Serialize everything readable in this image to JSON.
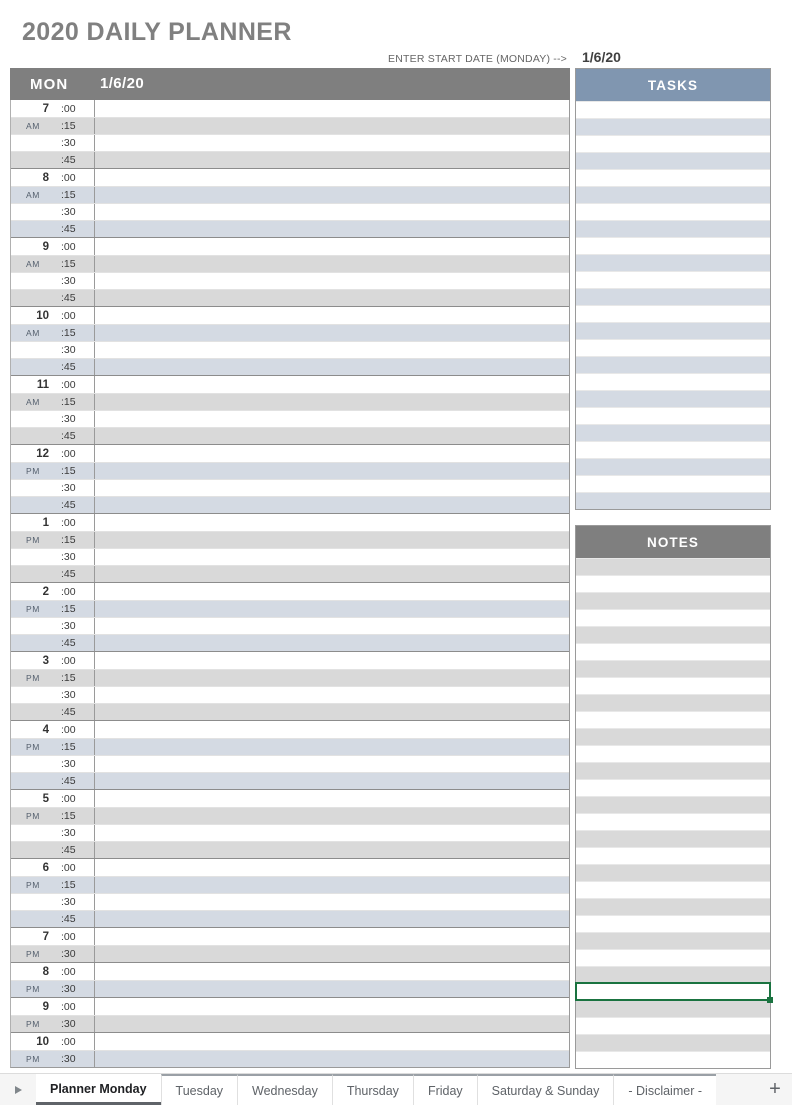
{
  "document": {
    "title": "2020 DAILY PLANNER"
  },
  "header": {
    "start_date_prompt": "ENTER START DATE (MONDAY) -->",
    "start_date_value": "1/6/20",
    "day_of_week": "MON",
    "day_date": "1/6/20"
  },
  "colors": {
    "title_gray": "#808080",
    "header_gray": "#7f7f7f",
    "tasks_blue": "#8096b0",
    "stripe_gray": "#d9d9d9",
    "stripe_blue": "#d4dae3",
    "selection_green": "#1a7340"
  },
  "schedule": {
    "hours": [
      {
        "hour": "7",
        "ampm": "AM",
        "stripe": "gray",
        "minutes": [
          ":00",
          ":15",
          ":30",
          ":45"
        ]
      },
      {
        "hour": "8",
        "ampm": "AM",
        "stripe": "blue",
        "minutes": [
          ":00",
          ":15",
          ":30",
          ":45"
        ]
      },
      {
        "hour": "9",
        "ampm": "AM",
        "stripe": "gray",
        "minutes": [
          ":00",
          ":15",
          ":30",
          ":45"
        ]
      },
      {
        "hour": "10",
        "ampm": "AM",
        "stripe": "blue",
        "minutes": [
          ":00",
          ":15",
          ":30",
          ":45"
        ]
      },
      {
        "hour": "11",
        "ampm": "AM",
        "stripe": "gray",
        "minutes": [
          ":00",
          ":15",
          ":30",
          ":45"
        ]
      },
      {
        "hour": "12",
        "ampm": "PM",
        "stripe": "blue",
        "minutes": [
          ":00",
          ":15",
          ":30",
          ":45"
        ]
      },
      {
        "hour": "1",
        "ampm": "PM",
        "stripe": "gray",
        "minutes": [
          ":00",
          ":15",
          ":30",
          ":45"
        ]
      },
      {
        "hour": "2",
        "ampm": "PM",
        "stripe": "blue",
        "minutes": [
          ":00",
          ":15",
          ":30",
          ":45"
        ]
      },
      {
        "hour": "3",
        "ampm": "PM",
        "stripe": "gray",
        "minutes": [
          ":00",
          ":15",
          ":30",
          ":45"
        ]
      },
      {
        "hour": "4",
        "ampm": "PM",
        "stripe": "blue",
        "minutes": [
          ":00",
          ":15",
          ":30",
          ":45"
        ]
      },
      {
        "hour": "5",
        "ampm": "PM",
        "stripe": "gray",
        "minutes": [
          ":00",
          ":15",
          ":30",
          ":45"
        ]
      },
      {
        "hour": "6",
        "ampm": "PM",
        "stripe": "blue",
        "minutes": [
          ":00",
          ":15",
          ":30",
          ":45"
        ]
      },
      {
        "hour": "7",
        "ampm": "PM",
        "stripe": "gray",
        "minutes": [
          ":00",
          ":30"
        ]
      },
      {
        "hour": "8",
        "ampm": "PM",
        "stripe": "blue",
        "minutes": [
          ":00",
          ":30"
        ]
      },
      {
        "hour": "9",
        "ampm": "PM",
        "stripe": "gray",
        "minutes": [
          ":00",
          ":30"
        ]
      },
      {
        "hour": "10",
        "ampm": "PM",
        "stripe": "blue",
        "minutes": [
          ":00",
          ":30"
        ]
      }
    ]
  },
  "tasks_panel": {
    "heading": "TASKS",
    "row_count": 24,
    "first_row_stripe": "white",
    "stripe": "blue",
    "values": []
  },
  "notes_panel": {
    "heading": "NOTES",
    "row_count": 30,
    "first_row_stripe": "gray",
    "stripe": "gray",
    "selected_row_index": 25,
    "values": []
  },
  "tabbar": {
    "scroll_left_icon": "triangle-right-icon",
    "add_sheet_label": "+",
    "tabs": [
      {
        "label": "Planner Monday",
        "active": true
      },
      {
        "label": "Tuesday",
        "active": false
      },
      {
        "label": "Wednesday",
        "active": false
      },
      {
        "label": "Thursday",
        "active": false
      },
      {
        "label": "Friday",
        "active": false
      },
      {
        "label": "Saturday & Sunday",
        "active": false
      },
      {
        "label": "- Disclaimer -",
        "active": false
      }
    ]
  }
}
